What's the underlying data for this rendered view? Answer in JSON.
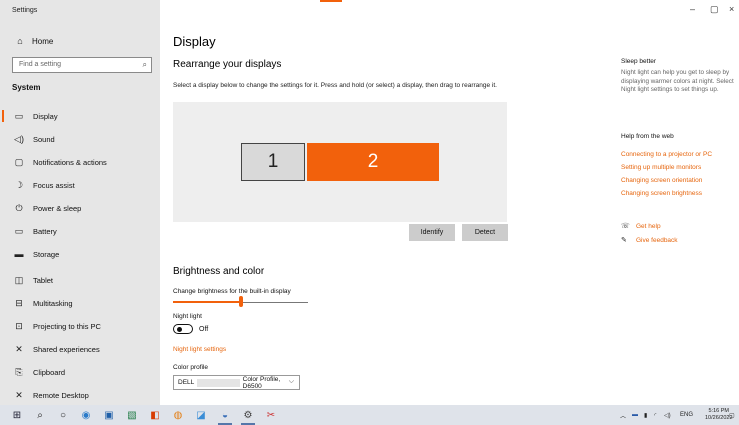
{
  "window": {
    "title": "Settings",
    "controls": [
      "–",
      "▢",
      "×"
    ]
  },
  "sidebar": {
    "home_label": "Home",
    "search_placeholder": "Find a setting",
    "section": "System",
    "items": [
      {
        "label": "Display",
        "icon": "monitor-icon"
      },
      {
        "label": "Sound",
        "icon": "speaker-icon"
      },
      {
        "label": "Notifications & actions",
        "icon": "notification-icon"
      },
      {
        "label": "Focus assist",
        "icon": "moon-icon"
      },
      {
        "label": "Power & sleep",
        "icon": "power-icon"
      },
      {
        "label": "Battery",
        "icon": "battery-icon"
      },
      {
        "label": "Storage",
        "icon": "storage-icon"
      },
      {
        "label": "Tablet",
        "icon": "tablet-icon"
      },
      {
        "label": "Multitasking",
        "icon": "multitasking-icon"
      },
      {
        "label": "Projecting to this PC",
        "icon": "projecting-icon"
      },
      {
        "label": "Shared experiences",
        "icon": "shared-icon"
      },
      {
        "label": "Clipboard",
        "icon": "clipboard-icon"
      },
      {
        "label": "Remote Desktop",
        "icon": "remote-icon"
      }
    ]
  },
  "main": {
    "title": "Display",
    "rearrange_title": "Rearrange your displays",
    "rearrange_desc": "Select a display below to change the settings for it. Press and hold (or select) a display, then drag to rearrange it.",
    "monitor1": "1",
    "monitor2": "2",
    "identify_label": "Identify",
    "detect_label": "Detect",
    "brightness_title": "Brightness and color",
    "brightness_label": "Change brightness for the built-in display",
    "brightness_level": 0.5,
    "night_light_label": "Night light",
    "night_light_state": "Off",
    "night_light_settings": "Night light settings",
    "color_profile_label": "Color profile",
    "color_profile_prefix": "DELL",
    "color_profile_suffix": "Color Profile, D6500"
  },
  "right": {
    "sleep_title": "Sleep better",
    "sleep_text": "Night light can help you get to sleep by displaying warmer colors at night. Select Night light settings to set things up.",
    "help_title": "Help from the web",
    "help_links": [
      "Connecting to a projector or PC",
      "Setting up multiple monitors",
      "Changing screen orientation",
      "Changing screen brightness"
    ],
    "get_help": "Get help",
    "give_feedback": "Give feedback"
  },
  "taskbar": {
    "tray_lang": "ENG",
    "time": "5:16 PM",
    "date": "10/26/2022"
  },
  "colors": {
    "accent": "#f2610c",
    "link": "#e6650d",
    "sidebar_bg": "#e6e6e6"
  }
}
